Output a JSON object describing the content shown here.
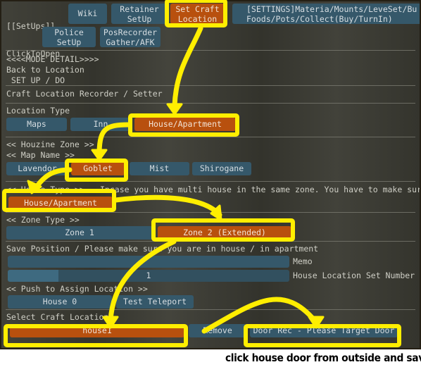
{
  "topbar": {
    "title_line1": "[[SetUps]]",
    "title_line2": "ClickToOpen",
    "buttons": [
      {
        "label": "Wiki",
        "selected": false
      },
      {
        "label": "Retainer\nSetUp",
        "selected": false
      },
      {
        "label": "Set Craft\nLocation",
        "selected": true
      },
      {
        "label": "[SETTINGS]Materia/Mounts/LeveSet/Bu\nFoods/Pots/Collect(Buy/TurnIn)",
        "selected": false
      },
      {
        "label": "Police\nSetUp",
        "selected": false
      },
      {
        "label": "PosRecorder\nGather/AFK",
        "selected": false
      }
    ]
  },
  "mode": {
    "header": "<<<<MODE DETAIL>>>>",
    "line1": "Back to Location",
    "line2": " SET UP / DO"
  },
  "section": {
    "title": "Craft Location Recorder / Setter"
  },
  "location_type": {
    "label": "Location Type",
    "options": [
      {
        "label": "Maps",
        "selected": false
      },
      {
        "label": "Inn",
        "selected": false
      },
      {
        "label": "House/Apartment",
        "selected": true
      }
    ]
  },
  "houzine": {
    "zone_label": "<< Houzine Zone >>",
    "map_label": "<< Map Name >>",
    "maps": [
      {
        "label": "Lavendor",
        "selected": false
      },
      {
        "label": "Goblet",
        "selected": true
      },
      {
        "label": "Mist",
        "selected": false
      },
      {
        "label": "Shirogane",
        "selected": false
      }
    ]
  },
  "house_type": {
    "label": "<< House Type >>",
    "hint": "Incase you have multi house in the same zone. You have to make sur",
    "options": [
      {
        "label": "House/Apartment",
        "selected": true
      }
    ]
  },
  "zone_type": {
    "label": "<< Zone Type >>",
    "options": [
      {
        "label": "Zone 1",
        "selected": false
      },
      {
        "label": "Zone 2 (Extended)",
        "selected": true
      }
    ]
  },
  "save_position": {
    "label": "Save Position / Please make sure you are in house / in apartment",
    "memo": {
      "value": "",
      "field_label": "Memo"
    },
    "set_number": {
      "value": "1",
      "field_label": "House Location Set Number",
      "fill_percent": 18
    }
  },
  "assign": {
    "label": "<< Push to Assign Location >>",
    "buttons": [
      {
        "label": "House 0",
        "selected": false
      },
      {
        "label": "Test Teleport",
        "selected": false
      }
    ]
  },
  "select_craft": {
    "label": "Select Craft Location",
    "entry": {
      "label": "house1",
      "selected": true
    },
    "remove": {
      "label": "Remove",
      "selected": false
    },
    "door_rec": {
      "label": "Door Rec - Please Target Door",
      "selected": false
    }
  },
  "caption": "click house door from outside and save it",
  "colors": {
    "selected_orange": "#b8500e",
    "button_teal": "#35586a",
    "panel_background": "#3a3a32",
    "annotation_yellow": "#ffee00",
    "text_light": "#cfcfc6"
  }
}
